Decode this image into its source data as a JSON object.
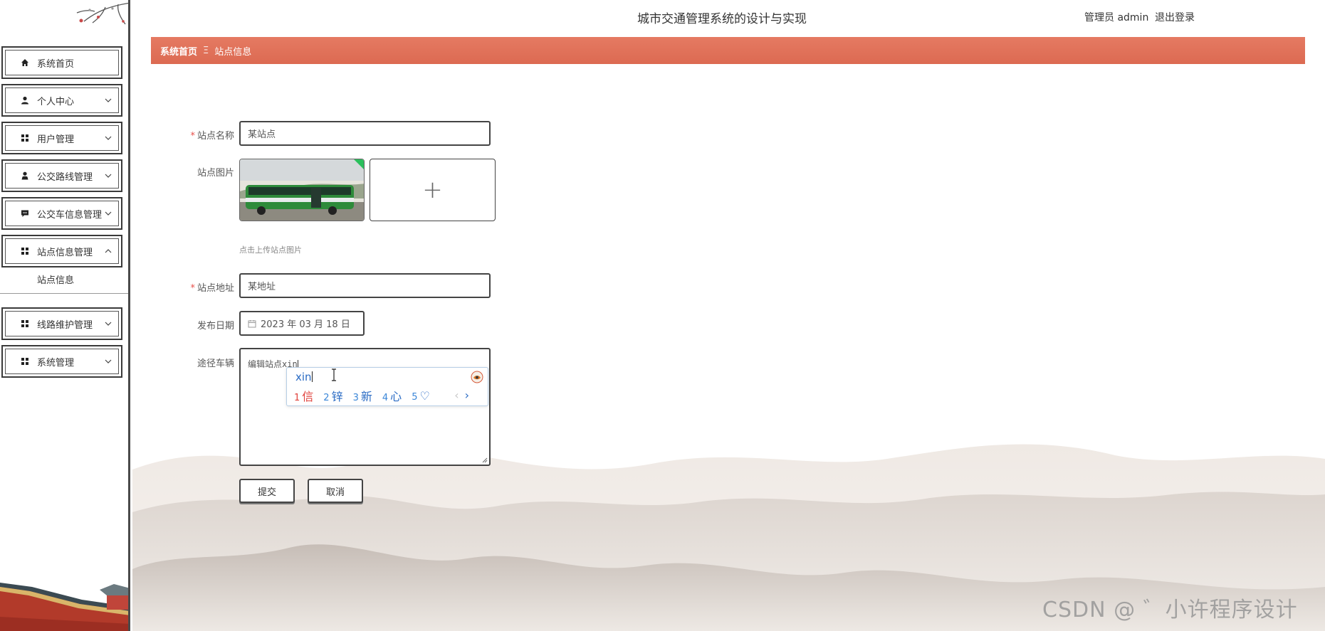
{
  "header": {
    "title": "城市交通管理系统的设计与实现",
    "user": "管理员 admin",
    "logout": "退出登录"
  },
  "breadcrumb": {
    "home": "系统首页",
    "separator": "Ξ",
    "current": "站点信息"
  },
  "sidebar": {
    "items": [
      {
        "label": "系统首页",
        "icon": "home-icon"
      },
      {
        "label": "个人中心",
        "icon": "user-icon",
        "chevron": "down"
      },
      {
        "label": "用户管理",
        "icon": "grid-icon",
        "chevron": "down"
      },
      {
        "label": "公交路线管理",
        "icon": "person-icon",
        "chevron": "down"
      },
      {
        "label": "公交车信息管理",
        "icon": "chat-icon",
        "chevron": "down"
      },
      {
        "label": "站点信息管理",
        "icon": "grid-icon",
        "chevron": "up"
      },
      {
        "label": "线路维护管理",
        "icon": "grid-icon",
        "chevron": "down"
      },
      {
        "label": "系统管理",
        "icon": "grid-icon",
        "chevron": "down"
      }
    ],
    "sub_item": "站点信息"
  },
  "form": {
    "station_name": {
      "label": "站点名称",
      "required": "*",
      "value": "某站点"
    },
    "station_image": {
      "label": "站点图片",
      "hint": "点击上传站点图片",
      "upload_symbol": "+"
    },
    "station_address": {
      "label": "站点地址",
      "required": "*",
      "value": "某地址"
    },
    "publish_date": {
      "label": "发布日期",
      "value": "2023 年 03 月 18 日"
    },
    "vehicles": {
      "label": "途径车辆",
      "value": "编辑站点xin"
    },
    "submit": "提交",
    "cancel": "取消"
  },
  "ime": {
    "composition": "xin",
    "candidates": [
      {
        "num": "1",
        "text": "信"
      },
      {
        "num": "2",
        "text": "锌"
      },
      {
        "num": "3",
        "text": "新"
      },
      {
        "num": "4",
        "text": "心"
      },
      {
        "num": "5",
        "text": "♡"
      }
    ],
    "prev": "‹",
    "next": "›"
  },
  "watermark": "CSDN @ ゛小许程序设计",
  "colors": {
    "breadcrumb_bg": "#e0705a",
    "required": "#e8504a",
    "ime_text": "#2a6bc4",
    "ime_first": "#e0403a",
    "bus_green": "#2e8b3a"
  }
}
